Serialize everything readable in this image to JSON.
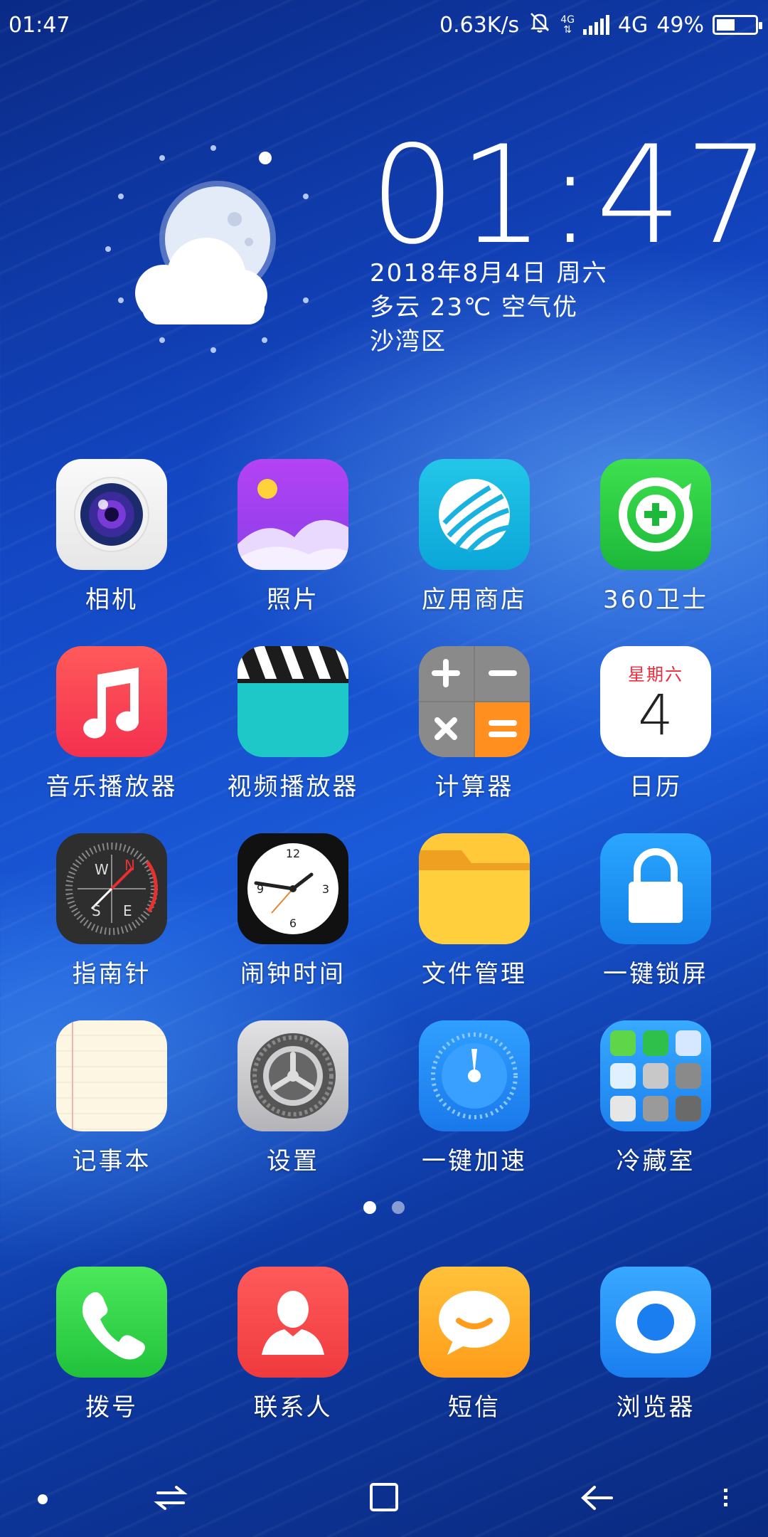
{
  "status_bar": {
    "time": "01:47",
    "net_speed": "0.63K/s",
    "network": "4G",
    "network_small": "4G",
    "battery_percent": "49%",
    "battery_level": 0.49,
    "icons": [
      "bell-muted-icon",
      "data-arrows-icon",
      "signal-icon",
      "battery-icon"
    ]
  },
  "widget": {
    "clock": "01:47",
    "date": "2018年8月4日 周六",
    "weather": "多云 23℃ 空气优",
    "location": "沙湾区",
    "weather_icon": "moon-cloud-icon"
  },
  "apps": [
    {
      "label": "相机",
      "icon": "camera-icon"
    },
    {
      "label": "照片",
      "icon": "photos-icon"
    },
    {
      "label": "应用商店",
      "icon": "app-store-icon"
    },
    {
      "label": "360卫士",
      "icon": "security-360-icon"
    },
    {
      "label": "音乐播放器",
      "icon": "music-icon"
    },
    {
      "label": "视频播放器",
      "icon": "video-clapper-icon"
    },
    {
      "label": "计算器",
      "icon": "calculator-icon"
    },
    {
      "label": "日历",
      "icon": "calendar-icon",
      "weekday": "星期六",
      "day": "4"
    },
    {
      "label": "指南针",
      "icon": "compass-icon"
    },
    {
      "label": "闹钟时间",
      "icon": "clock-icon"
    },
    {
      "label": "文件管理",
      "icon": "folder-icon"
    },
    {
      "label": "一键锁屏",
      "icon": "lock-icon"
    },
    {
      "label": "记事本",
      "icon": "notepad-icon"
    },
    {
      "label": "设置",
      "icon": "settings-gear-icon"
    },
    {
      "label": "一键加速",
      "icon": "speed-gauge-icon"
    },
    {
      "label": "冷藏室",
      "icon": "folder-grid-icon"
    }
  ],
  "pager": {
    "pages": 2,
    "current": 1
  },
  "dock": [
    {
      "label": "拨号",
      "icon": "phone-icon"
    },
    {
      "label": "联系人",
      "icon": "contacts-icon"
    },
    {
      "label": "短信",
      "icon": "message-icon"
    },
    {
      "label": "浏览器",
      "icon": "browser-icon"
    }
  ],
  "navbar": [
    "dot-icon",
    "switch-arrows-icon",
    "home-square-icon",
    "back-arrow-icon",
    "menu-dots-icon"
  ]
}
